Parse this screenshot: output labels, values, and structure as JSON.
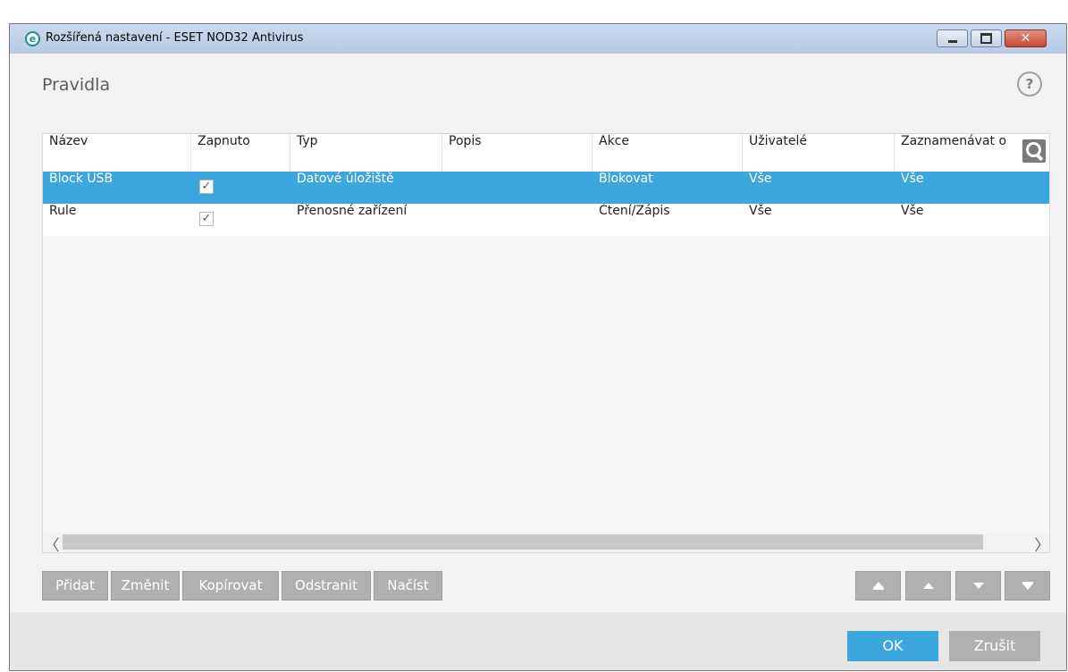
{
  "window": {
    "title": "Rozšířená nastavení - ESET NOD32 Antivirus",
    "app_icon_letter": "e",
    "close_glyph": "✕"
  },
  "page": {
    "title": "Pravidla",
    "help_glyph": "?"
  },
  "table": {
    "columns": [
      "Název",
      "Zapnuto",
      "Typ",
      "Popis",
      "Akce",
      "Uživatelé",
      "Zaznamenávat o"
    ],
    "rows": [
      {
        "name": "Block USB",
        "enabled": true,
        "type": "Datové úložiště",
        "description": "",
        "action": "Blokovat",
        "users": "Vše",
        "log": "Vše",
        "selected": true
      },
      {
        "name": "Rule",
        "enabled": true,
        "type": "Přenosné zařízení",
        "description": "",
        "action": "Čtení/Zápis",
        "users": "Vše",
        "log": "Vše",
        "selected": false
      }
    ],
    "check_glyph": "✓",
    "scroll_left": "〈",
    "scroll_right": "〉"
  },
  "actions": {
    "add": "Přidat",
    "edit": "Změnit",
    "copy": "Kopírovat",
    "delete": "Odstranit",
    "load": "Načíst"
  },
  "footer": {
    "ok": "OK",
    "cancel": "Zrušit"
  },
  "colors": {
    "accent": "#3ca6de",
    "button_gray": "#aeb0b1"
  }
}
